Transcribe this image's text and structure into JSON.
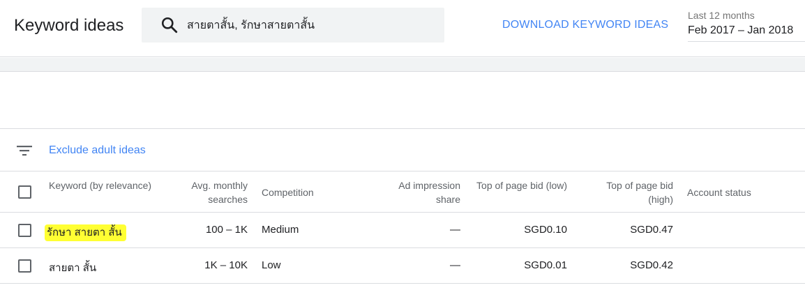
{
  "header": {
    "title": "Keyword ideas",
    "search_value": "สายตาสั้น, รักษาสายตาสั้น",
    "download_label": "DOWNLOAD KEYWORD IDEAS",
    "date_label": "Last 12 months",
    "date_value": "Feb 2017 – Jan 2018"
  },
  "filter": {
    "icon": "filter-list-icon",
    "link_label": "Exclude adult ideas"
  },
  "table": {
    "columns": {
      "keyword": "Keyword (by relevance)",
      "avg": "Avg. monthly searches",
      "competition": "Competition",
      "ad_share": "Ad impression share",
      "bid_low": "Top of page bid (low)",
      "bid_high": "Top of page bid (high)",
      "account": "Account status"
    },
    "rows": [
      {
        "keyword": "รักษา สายตา สั้น",
        "avg": "100 – 1K",
        "competition": "Medium",
        "ad_share": "—",
        "bid_low": "SGD0.10",
        "bid_high": "SGD0.47",
        "account": ""
      },
      {
        "keyword": "สายตา สั้น",
        "avg": "1K – 10K",
        "competition": "Low",
        "ad_share": "—",
        "bid_low": "SGD0.01",
        "bid_high": "SGD0.42",
        "account": ""
      }
    ]
  },
  "colors": {
    "accent": "#4285f4",
    "highlight": "#ffff33"
  }
}
